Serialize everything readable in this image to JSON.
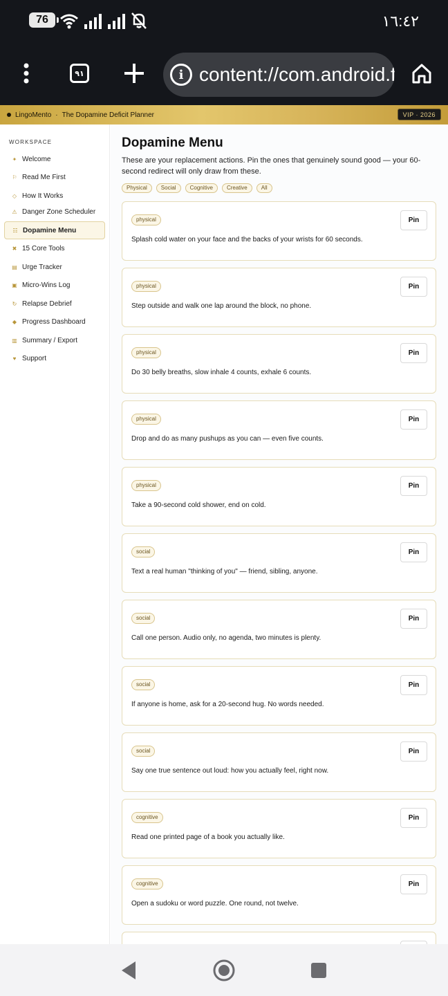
{
  "status": {
    "battery": "76",
    "clock": "١٦:٤٢"
  },
  "browser": {
    "tab_count": "٩١",
    "url": "content://com.android.fi"
  },
  "app": {
    "brand": "LingoMento",
    "separator": "·",
    "planner": "The Dopamine Deficit Planner",
    "badge": "VIP · 2026"
  },
  "sidebar": {
    "heading": "WORKSPACE",
    "items": [
      {
        "label": "Welcome",
        "icon": "✦"
      },
      {
        "label": "Read Me First",
        "icon": "⚐"
      },
      {
        "label": "How It Works",
        "icon": "◇"
      },
      {
        "label": "Danger Zone Scheduler",
        "icon": "⚠"
      },
      {
        "label": "Dopamine Menu",
        "icon": "☷"
      },
      {
        "label": "15 Core Tools",
        "icon": "✖"
      },
      {
        "label": "Urge Tracker",
        "icon": "▤"
      },
      {
        "label": "Micro-Wins Log",
        "icon": "▣"
      },
      {
        "label": "Relapse Debrief",
        "icon": "↻"
      },
      {
        "label": "Progress Dashboard",
        "icon": "◆"
      },
      {
        "label": "Summary / Export",
        "icon": "▥"
      },
      {
        "label": "Support",
        "icon": "♥"
      }
    ]
  },
  "main": {
    "title": "Dopamine Menu",
    "description": "These are your replacement actions. Pin the ones that genuinely sound good — your 60-second redirect will only draw from these.",
    "filters": [
      "Physical",
      "Social",
      "Cognitive",
      "Creative",
      "All"
    ],
    "pin_label": "Pin",
    "cards": [
      {
        "tag": "physical",
        "text": "Splash cold water on your face and the backs of your wrists for 60 seconds."
      },
      {
        "tag": "physical",
        "text": "Step outside and walk one lap around the block, no phone."
      },
      {
        "tag": "physical",
        "text": "Do 30 belly breaths, slow inhale 4 counts, exhale 6 counts."
      },
      {
        "tag": "physical",
        "text": "Drop and do as many pushups as you can — even five counts."
      },
      {
        "tag": "physical",
        "text": "Take a 90-second cold shower, end on cold."
      },
      {
        "tag": "social",
        "text": "Text a real human \"thinking of you\" — friend, sibling, anyone."
      },
      {
        "tag": "social",
        "text": "Call one person. Audio only, no agenda, two minutes is plenty."
      },
      {
        "tag": "social",
        "text": "If anyone is home, ask for a 20-second hug. No words needed."
      },
      {
        "tag": "social",
        "text": "Say one true sentence out loud: how you actually feel, right now."
      },
      {
        "tag": "cognitive",
        "text": "Read one printed page of a book you actually like."
      },
      {
        "tag": "cognitive",
        "text": "Open a sudoku or word puzzle. One round, not twelve."
      },
      {
        "tag": "cognitive",
        "text": ""
      }
    ]
  }
}
